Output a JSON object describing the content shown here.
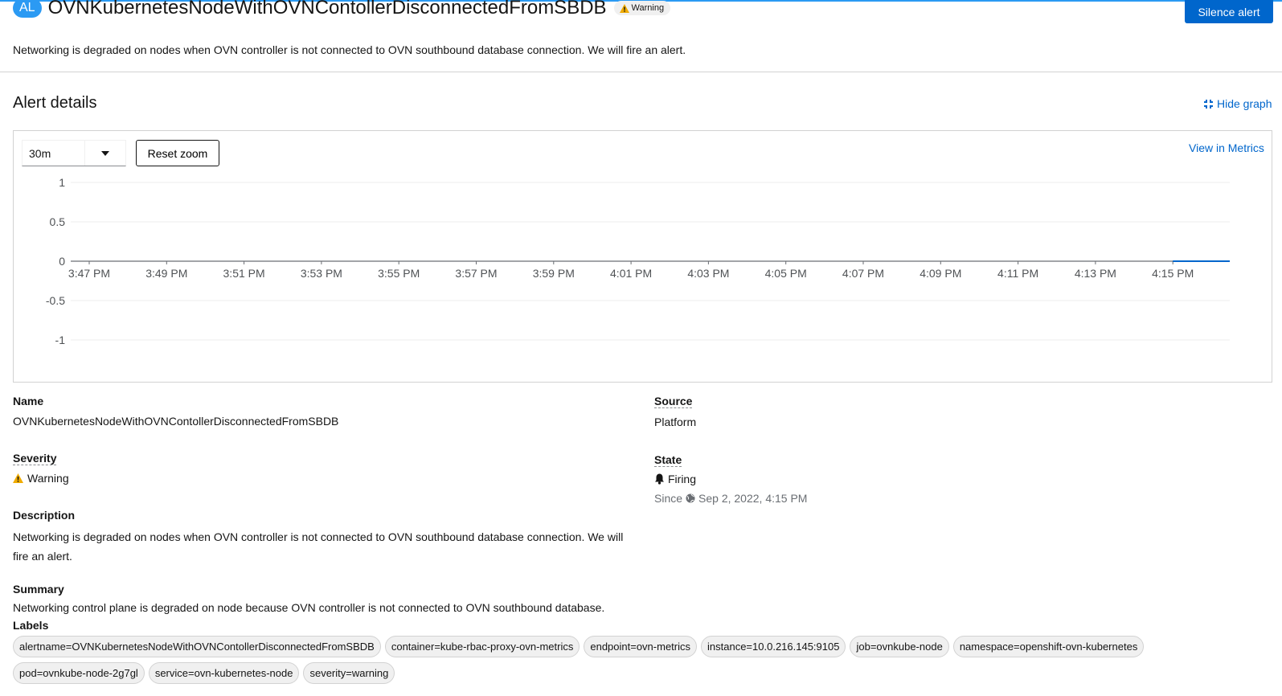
{
  "header": {
    "badge": "AL",
    "title": "OVNKubernetesNodeWithOVNContollerDisconnectedFromSBDB",
    "severity_tag": "Warning",
    "silence_label": "Silence alert",
    "intro": "Networking is degraded on nodes when OVN controller is not connected to OVN southbound database connection. We will fire an alert."
  },
  "details_section": {
    "title": "Alert details",
    "hide_graph": "Hide graph"
  },
  "graph": {
    "timespan": "30m",
    "reset_zoom": "Reset zoom",
    "view_in_metrics": "View in Metrics"
  },
  "chart_data": {
    "type": "line",
    "y_ticks": [
      "1",
      "0.5",
      "0",
      "-0.5",
      "-1"
    ],
    "ylim": [
      -1,
      1
    ],
    "x_ticks": [
      "3:47 PM",
      "3:49 PM",
      "3:51 PM",
      "3:53 PM",
      "3:55 PM",
      "3:57 PM",
      "3:59 PM",
      "4:01 PM",
      "4:03 PM",
      "4:05 PM",
      "4:07 PM",
      "4:09 PM",
      "4:11 PM",
      "4:13 PM",
      "4:15 PM"
    ],
    "series": [
      {
        "color": "#0066cc",
        "x": [
          "4:15 PM",
          "4:16.5 PM"
        ],
        "values": [
          0,
          0
        ]
      }
    ]
  },
  "fields": {
    "name_label": "Name",
    "name_value": "OVNKubernetesNodeWithOVNContollerDisconnectedFromSBDB",
    "severity_label": "Severity",
    "severity_value": "Warning",
    "description_label": "Description",
    "description_line1": "Networking is degraded on nodes when OVN controller is not connected to OVN southbound database connection. We will",
    "description_line2": "fire an alert.",
    "summary_label": "Summary",
    "summary_value": "Networking control plane is degraded on node because OVN controller is not connected to OVN southbound database.",
    "labels_label": "Labels",
    "source_label": "Source",
    "source_value": "Platform",
    "state_label": "State",
    "state_value": "Firing",
    "since_label": "Since",
    "since_value": "Sep 2, 2022, 4:15 PM"
  },
  "labels": [
    "alertname=OVNKubernetesNodeWithOVNContollerDisconnectedFromSBDB",
    "container=kube-rbac-proxy-ovn-metrics",
    "endpoint=ovn-metrics",
    "instance=10.0.216.145:9105",
    "job=ovnkube-node",
    "namespace=openshift-ovn-kubernetes",
    "pod=ovnkube-node-2g7gl",
    "service=ovn-kubernetes-node",
    "severity=warning"
  ]
}
